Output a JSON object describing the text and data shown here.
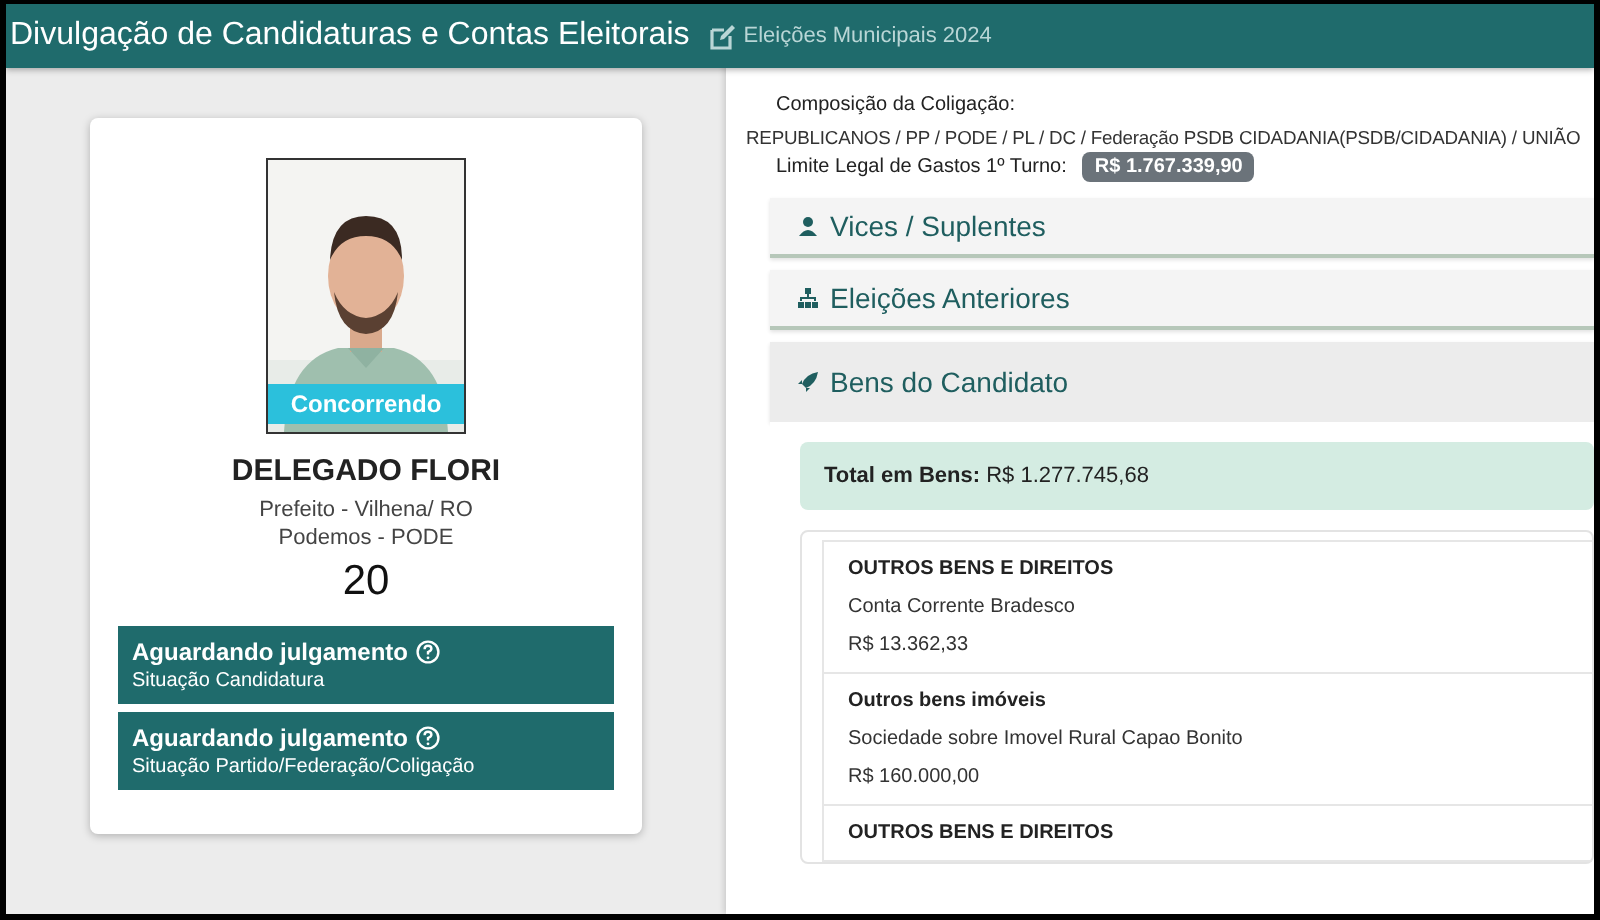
{
  "header": {
    "title": "Divulgação de Candidaturas e Contas Eleitorais",
    "subtitle": "Eleições Municipais 2024"
  },
  "candidate": {
    "status_badge": "Concorrendo",
    "name": "DELEGADO FLORI",
    "office": "Prefeito - Vilhena/ RO",
    "party": "Podemos - PODE",
    "number": "20",
    "situations": [
      {
        "title": "Aguardando julgamento",
        "label": "Situação Candidatura"
      },
      {
        "title": "Aguardando julgamento",
        "label": "Situação Partido/Federação/Coligação"
      }
    ]
  },
  "details": {
    "composition_label": "Composição da Coligação:",
    "composition": "REPUBLICANOS / PP / PODE / PL / DC / Federação PSDB CIDADANIA(PSDB/CIDADANIA) / UNIÃO",
    "spending_limit": {
      "label": "Limite Legal de Gastos 1º Turno:",
      "value": "R$ 1.767.339,90"
    }
  },
  "accordion": [
    {
      "title": "Vices / Suplentes",
      "expanded": false
    },
    {
      "title": "Eleições Anteriores",
      "expanded": false
    },
    {
      "title": "Bens do Candidato",
      "expanded": true
    }
  ],
  "assets": {
    "total_label": "Total em Bens:",
    "total": "R$ 1.277.745,68",
    "items": [
      {
        "type": "OUTROS BENS E DIREITOS",
        "description": "Conta Corrente Bradesco",
        "value": "R$ 13.362,33"
      },
      {
        "type": "Outros bens imóveis",
        "description": "Sociedade sobre Imovel Rural Capao Bonito",
        "value": "R$ 160.000,00"
      },
      {
        "type": "OUTROS BENS E DIREITOS"
      }
    ]
  }
}
